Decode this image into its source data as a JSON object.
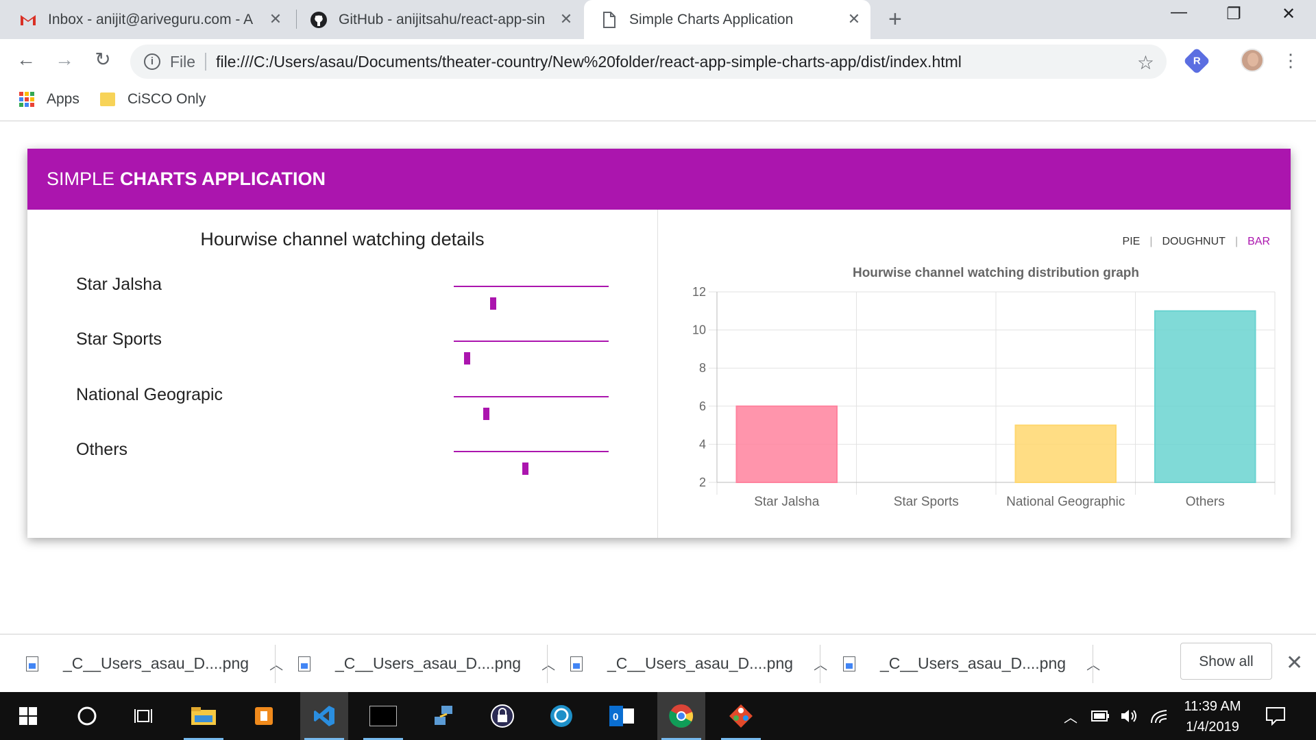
{
  "browser": {
    "tabs": [
      {
        "title": "Inbox - anijit@ariveguru.com - A",
        "icon": "gmail-icon",
        "active": false
      },
      {
        "title": "GitHub - anijitsahu/react-app-sin",
        "icon": "github-icon",
        "active": false
      },
      {
        "title": "Simple Charts Application",
        "icon": "page-icon",
        "active": true
      }
    ],
    "address": {
      "scheme_label": "File",
      "url": "file:///C:/Users/asau/Documents/theater-country/New%20folder/react-app-simple-charts-app/dist/index.html"
    },
    "extension_badge": "R",
    "bookmarks": [
      {
        "label": "Apps",
        "icon": "apps-grid-icon"
      },
      {
        "label": "CiSCO Only",
        "icon": "folder-icon"
      }
    ]
  },
  "app": {
    "header": {
      "prefix": "SIMPLE",
      "bold": "CHARTS APPLICATION"
    },
    "left_title": "Hourwise channel watching details",
    "sliders": [
      {
        "label": "Star Jalsha",
        "value": 6
      },
      {
        "label": "Star Sports",
        "value": 2
      },
      {
        "label": "National Geograpic",
        "value": 5
      },
      {
        "label": "Others",
        "value": 11
      }
    ],
    "slider_max": 24,
    "chart_tabs": [
      "PIE",
      "DOUGHNUT",
      "BAR"
    ],
    "active_chart_tab": "BAR",
    "accent_color": "#ab15ae"
  },
  "chart_data": {
    "type": "bar",
    "title": "Hourwise channel watching distribution graph",
    "categories": [
      "Star Jalsha",
      "Star Sports",
      "National Geographic",
      "Others"
    ],
    "values": [
      6,
      2,
      5,
      11
    ],
    "colors": [
      "#ff829e",
      "#5ab5f0",
      "#ffd76e",
      "#6ad3d0"
    ],
    "ylim": [
      2,
      12
    ],
    "yticks": [
      2,
      4,
      6,
      8,
      10,
      12
    ],
    "grid": true,
    "legend": "none"
  },
  "downloads": {
    "items": [
      "_C__Users_asau_D....png",
      "_C__Users_asau_D....png",
      "_C__Users_asau_D....png",
      "_C__Users_asau_D....png"
    ],
    "show_all": "Show all"
  },
  "taskbar": {
    "time": "11:39 AM",
    "date": "1/4/2019"
  }
}
